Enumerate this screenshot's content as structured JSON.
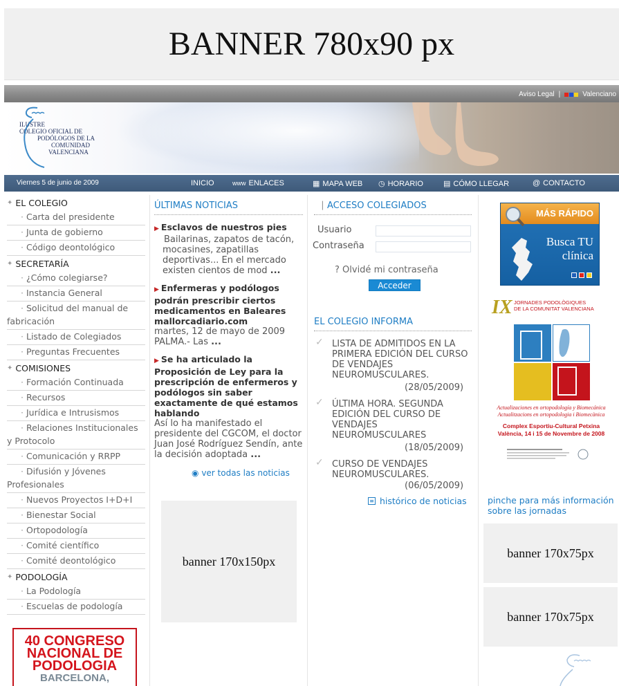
{
  "top_banner": {
    "text": "BANNER 780x90 px"
  },
  "legal_bar": {
    "aviso": "Aviso Legal",
    "separator": "|",
    "lang": "Valenciano",
    "flag_colors": [
      "#e3261c",
      "#1f4fd6",
      "#f4d21f"
    ]
  },
  "header": {
    "logo_lines": [
      "ILUSTRE",
      "COLEGIO OFICIAL DE",
      "PODÓLOGOS DE LA",
      "COMUNIDAD",
      "VALENCIANA"
    ]
  },
  "navbar": {
    "date": "Viernes 5 de junio de 2009",
    "items": [
      {
        "label": "INICIO",
        "icon": ""
      },
      {
        "label": "ENLACES",
        "icon": "www"
      },
      {
        "label": "MAPA WEB",
        "icon": "sitemap-icon"
      },
      {
        "label": "HORARIO",
        "icon": "clock-icon"
      },
      {
        "label": "CÓMO LLEGAR",
        "icon": "map-icon"
      },
      {
        "label": "CONTACTO",
        "icon": "at-icon"
      }
    ]
  },
  "left_menu": {
    "sections": [
      {
        "title": "EL COLEGIO",
        "items": [
          "Carta del presidente",
          "Junta de gobierno",
          "Código deontológico"
        ]
      },
      {
        "title": "SECRETARÍA",
        "items": [
          "¿Cómo colegiarse?",
          "Instancia General",
          "Solicitud del manual de fabricación",
          "Listado de Colegiados",
          "Preguntas Frecuentes"
        ]
      },
      {
        "title": "COMISIONES",
        "items": [
          "Formación Continuada",
          "Recursos",
          "Jurídica e Intrusismos",
          "Relaciones Institucionales y Protocolo",
          "Comunicación y RRPP",
          "Difusión y Jóvenes Profesionales",
          "Nuevos Proyectos I+D+I",
          "Bienestar Social",
          "Ortopodología",
          "Comité científico",
          "Comité deontológico"
        ]
      },
      {
        "title": "PODOLOGÍA",
        "items": [
          "La Podología",
          "Escuelas de podología"
        ]
      }
    ]
  },
  "congreso": {
    "lines": [
      "40 CONGRESO",
      "NACIONAL DE",
      "PODOLOGIA"
    ],
    "city": "BARCELONA,"
  },
  "news": {
    "title": "ÚLTIMAS NOTICIAS",
    "items": [
      {
        "title": "Esclavos de nuestros pies",
        "body": "Bailarinas, zapatos de tacón, mocasines, zapatillas deportivas... En el mercado existen cientos de mod",
        "more": "..."
      },
      {
        "title": "Enfermeras y podólogos podrán prescribir ciertos medicamentos en Baleares mallorcadiario.com",
        "body": "martes, 12 de mayo de 2009 PALMA.- Las",
        "more": "..."
      },
      {
        "title": "Se ha articulado la Proposición de Ley para la prescripción de enfermeros y podólogos sin saber exactamente de qué estamos hablando",
        "body": "Así lo ha manifestado el presidente del CGCOM, el doctor Juan José Rodríguez Sendín, ante la decisión adoptada",
        "more": "..."
      }
    ],
    "see_all": "ver todas las noticias"
  },
  "banner_170x150": "banner 170x150px",
  "access": {
    "title": "ACCESO COLEGIADOS",
    "user_label": "Usuario",
    "pass_label": "Contraseña",
    "forgot": "? Olvidé mi contraseña",
    "submit": "Acceder"
  },
  "informa": {
    "title": "EL COLEGIO INFORMA",
    "items": [
      {
        "text": "LISTA DE ADMITIDOS EN LA PRIMERA EDICIÓN DEL CURSO DE VENDAJES NEUROMUSCULARES.",
        "date": "(28/05/2009)"
      },
      {
        "text": "ÚLTIMA HORA. SEGUNDA EDICIÓN DEL CURSO DE VENDAJES NEUROMUSCULARES",
        "date": "(18/05/2009)"
      },
      {
        "text": "CURSO DE VENDAJES NEUROMUSCULARES.",
        "date": "(06/05/2009)"
      }
    ],
    "historico": "histórico de noticias"
  },
  "rapido": {
    "top": "MÁS RÁPIDO",
    "busca": [
      "Busca TU",
      "clínica"
    ]
  },
  "jornadas": {
    "ix": "IX",
    "title": [
      "JORNADES PODOLÒGIQUES",
      "DE LA COMUNITAT VALENCIANA"
    ],
    "lines1": [
      "Actualizaciones en ortopodología y Biomecánica",
      "Actualitzacions en ortopodologia i Biomecànica"
    ],
    "lines2": [
      "Complex Esportiu-Cultural Petxina",
      "València, 14 i 15 de Novembre de 2008"
    ]
  },
  "pinche": "pinche para más información sobre las jornadas",
  "banner_170x75_a": "banner 170x75px",
  "banner_170x75_b": "banner 170x75px"
}
